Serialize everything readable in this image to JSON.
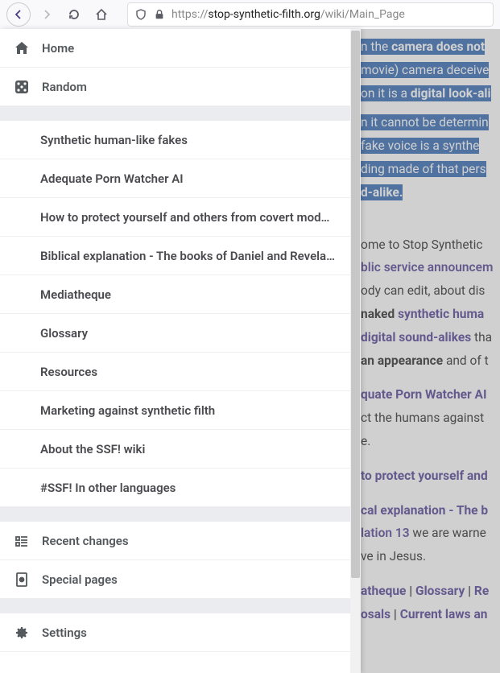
{
  "browser": {
    "url_prefix": "https://",
    "url_host": "stop-synthetic-filth.org",
    "url_path": "/wiki/Main_Page"
  },
  "drawer": {
    "top": [
      {
        "label": "Home",
        "icon": "home-icon"
      },
      {
        "label": "Random",
        "icon": "dice-icon"
      }
    ],
    "sub": [
      "Synthetic human-like fakes",
      "Adequate Porn Watcher AI",
      "How to protect yourself and others from covert mod…",
      "Biblical explanation - The books of Daniel and Revela…",
      "Mediatheque",
      "Glossary",
      "Resources",
      "Marketing against synthetic filth",
      "About the SSF! wiki",
      "#SSF! In other languages"
    ],
    "bottom1": [
      {
        "label": "Recent changes",
        "icon": "recent-icon"
      },
      {
        "label": "Special pages",
        "icon": "special-icon"
      }
    ],
    "bottom2": [
      {
        "label": "Settings",
        "icon": "gear-icon"
      }
    ]
  },
  "page": {
    "hl1a": "n the ",
    "hl1b": "camera does not",
    "hl2": "movie) camera deceive",
    "hl3a": "on it is a ",
    "hl3b": "digital look-ali",
    "hl4": "n it cannot be determin",
    "hl5": " fake voice is a synthe",
    "hl6": "ding made of that pers",
    "hl7": "d-alike.",
    "p1a": "ome to Stop Synthetic",
    "p1b": "blic service announcem",
    "p1c": "ody can edit, about dis",
    "p1d": "naked ",
    "p1e": "synthetic huma",
    "p1f": "digital sound-alikes",
    "p1g": " tha",
    "p1h": "an appearance",
    "p1i": " and of t",
    "p2a": "quate Porn Watcher AI",
    "p2b": "ct the humans against",
    "p2c": "e.",
    "p3": "to protect yourself and",
    "p4a": "cal explanation - The b",
    "p4b": "lation 13",
    "p4c": " we are warne",
    "p4d": "ve in Jesus.",
    "p5a": "atheque",
    "p5b": " | ",
    "p5c": "Glossary",
    "p5d": " | ",
    "p5e": "Re",
    "p5f": "osals",
    "p5g": " | ",
    "p5h": "Current laws an"
  }
}
